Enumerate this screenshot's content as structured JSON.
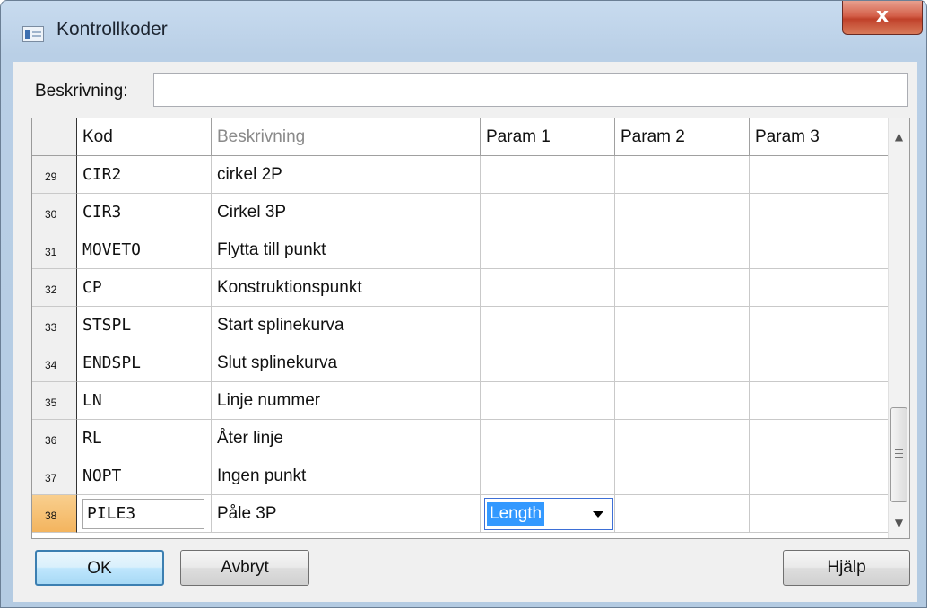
{
  "window": {
    "title": "Kontrollkoder",
    "close_label": "x"
  },
  "description": {
    "label": "Beskrivning:",
    "value": ""
  },
  "grid": {
    "columns": [
      "Kod",
      "Beskrivning",
      "Param 1",
      "Param 2",
      "Param 3"
    ],
    "rows": [
      {
        "num": "29",
        "code": "CIR2",
        "desc": "cirkel 2P"
      },
      {
        "num": "30",
        "code": "CIR3",
        "desc": "Cirkel 3P"
      },
      {
        "num": "31",
        "code": "MOVETO",
        "desc": "Flytta till punkt"
      },
      {
        "num": "32",
        "code": "CP",
        "desc": "Konstruktionspunkt"
      },
      {
        "num": "33",
        "code": "STSPL",
        "desc": "Start splinekurva"
      },
      {
        "num": "34",
        "code": "ENDSPL",
        "desc": "Slut splinekurva"
      },
      {
        "num": "35",
        "code": "LN",
        "desc": "Linje nummer"
      },
      {
        "num": "36",
        "code": "RL",
        "desc": "Åter linje"
      },
      {
        "num": "37",
        "code": "NOPT",
        "desc": "Ingen punkt"
      }
    ],
    "active_row": {
      "num": "38",
      "code": "PILE3",
      "desc": "Påle 3P",
      "param1": "Length"
    }
  },
  "buttons": {
    "ok": "OK",
    "cancel": "Avbryt",
    "help": "Hjälp"
  },
  "icons": {
    "scroll_up": "▲",
    "scroll_down": "▼"
  }
}
